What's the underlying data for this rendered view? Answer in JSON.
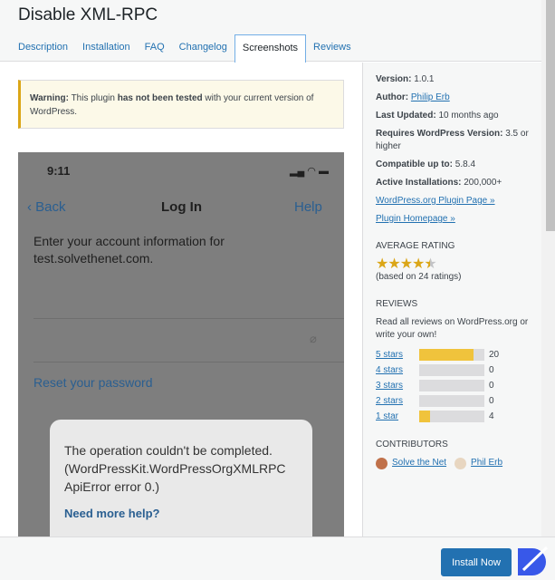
{
  "title": "Disable XML-RPC",
  "tabs": [
    "Description",
    "Installation",
    "FAQ",
    "Changelog",
    "Screenshots",
    "Reviews"
  ],
  "active_tab": "Screenshots",
  "warning": {
    "label": "Warning:",
    "pre": " This plugin ",
    "bold": "has not been tested",
    "post": " with your current version of WordPress."
  },
  "screenshot": {
    "time": "9:11",
    "back": "Back",
    "nav_title": "Log In",
    "help": "Help",
    "intro": "Enter your account information for test.solvethenet.com.",
    "reset": "Reset your password",
    "error": "The operation couldn't be completed. (WordPressKit.WordPressOrgXMLRPC ApiError error 0.)",
    "need_help": "Need more help?"
  },
  "sidebar": {
    "version_label": "Version:",
    "version": "1.0.1",
    "author_label": "Author:",
    "author": "Philip Erb",
    "updated_label": "Last Updated:",
    "updated": "10 months ago",
    "requires_label": "Requires WordPress Version:",
    "requires": "3.5 or higher",
    "compat_label": "Compatible up to:",
    "compat": "5.8.4",
    "installs_label": "Active Installations:",
    "installs": "200,000+",
    "plugin_page": "WordPress.org Plugin Page »",
    "homepage": "Plugin Homepage »",
    "avg_heading": "Average Rating",
    "rating": 4.5,
    "rating_note": "(based on 24 ratings)",
    "reviews_heading": "Reviews",
    "reviews_text": "Read all reviews on WordPress.org or write your own!",
    "ratings": [
      {
        "label": "5 stars",
        "count": "20",
        "fraction": 0.83
      },
      {
        "label": "4 stars",
        "count": "0",
        "fraction": 0
      },
      {
        "label": "3 stars",
        "count": "0",
        "fraction": 0
      },
      {
        "label": "2 stars",
        "count": "0",
        "fraction": 0
      },
      {
        "label": "1 star",
        "count": "4",
        "fraction": 0.17
      }
    ],
    "contrib_heading": "Contributors",
    "contributors": [
      "Solve the Net",
      "Phil Erb"
    ]
  },
  "footer": {
    "install": "Install Now"
  },
  "colors": {
    "accent": "#2271b1",
    "star": "#dba617",
    "bar": "#f0c33c"
  }
}
